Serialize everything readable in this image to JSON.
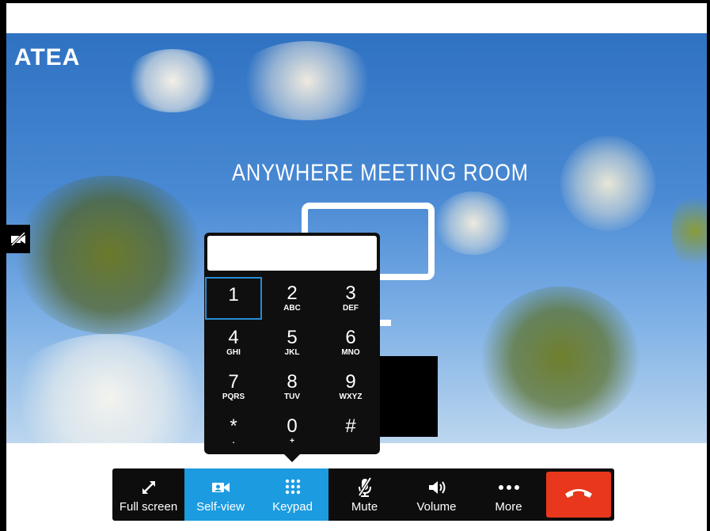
{
  "app": {
    "logo_text": "ATEA",
    "room_title": "ANYWHERE MEETING ROOM"
  },
  "keypad": {
    "display_value": "",
    "selected_key": "1",
    "keys": [
      {
        "num": "1",
        "letters": ""
      },
      {
        "num": "2",
        "letters": "ABC"
      },
      {
        "num": "3",
        "letters": "DEF"
      },
      {
        "num": "4",
        "letters": "GHI"
      },
      {
        "num": "5",
        "letters": "JKL"
      },
      {
        "num": "6",
        "letters": "MNO"
      },
      {
        "num": "7",
        "letters": "PQRS"
      },
      {
        "num": "8",
        "letters": "TUV"
      },
      {
        "num": "9",
        "letters": "WXYZ"
      },
      {
        "num": "*",
        "letters": "."
      },
      {
        "num": "0",
        "letters": "+"
      },
      {
        "num": "#",
        "letters": ""
      }
    ]
  },
  "toolbar": {
    "fullscreen": "Full screen",
    "selfview": "Self-view",
    "keypad": "Keypad",
    "mute": "Mute",
    "volume": "Volume",
    "more": "More"
  },
  "icons": {
    "camera_off": "camera-off-icon",
    "fullscreen": "expand-arrows-icon",
    "selfview": "camera-icon",
    "keypad": "dialpad-grid-icon",
    "mute": "microphone-muted-icon",
    "volume": "speaker-icon",
    "more": "ellipsis-icon",
    "hangup": "phone-hangup-icon"
  },
  "colors": {
    "active_tool": "#1c9be0",
    "hangup": "#e8371c",
    "selected_key_border": "#2a8bd3"
  }
}
